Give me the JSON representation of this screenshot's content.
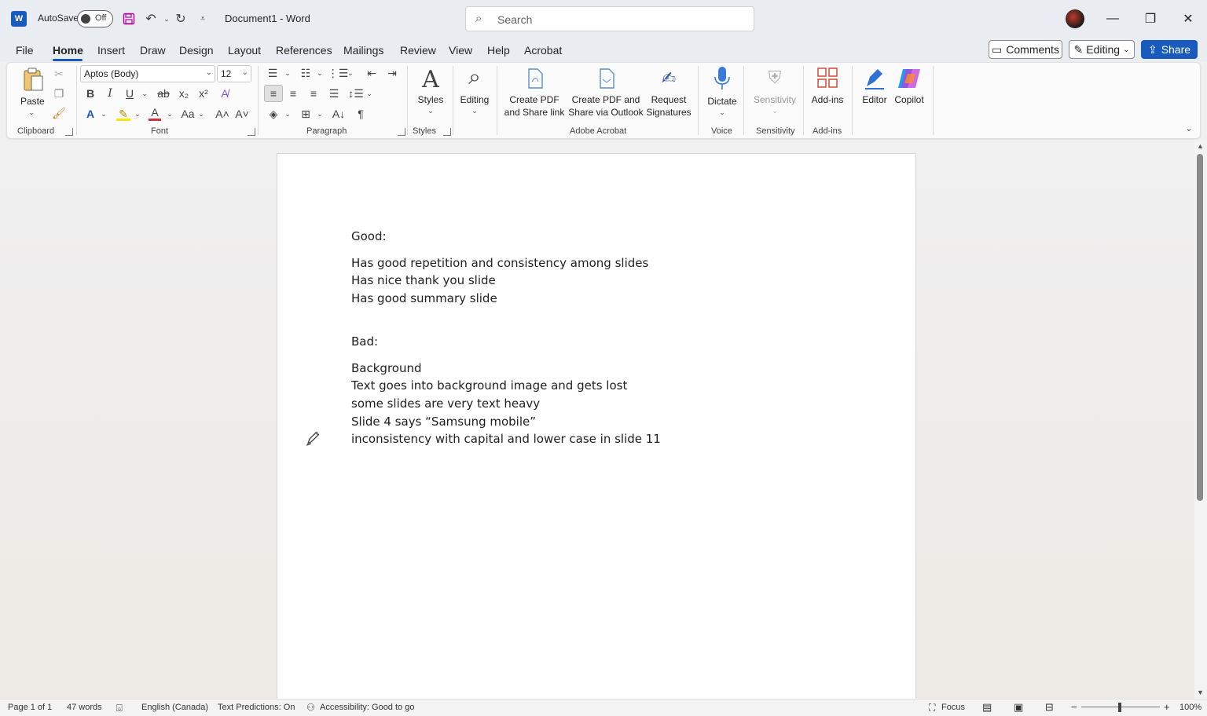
{
  "titlebar": {
    "app_logo": "W",
    "autosave_label": "AutoSave",
    "autosave_state": "Off",
    "document_title": "Document1 - Word",
    "search_placeholder": "Search"
  },
  "tabs": [
    "File",
    "Home",
    "Insert",
    "Draw",
    "Design",
    "Layout",
    "References",
    "Mailings",
    "Review",
    "View",
    "Help",
    "Acrobat"
  ],
  "active_tab": "Home",
  "actions": {
    "comments": "Comments",
    "editing": "Editing",
    "share": "Share"
  },
  "ribbon": {
    "clipboard": {
      "label": "Clipboard",
      "paste": "Paste"
    },
    "font": {
      "label": "Font",
      "font_name": "Aptos (Body)",
      "font_size": "12"
    },
    "paragraph": {
      "label": "Paragraph"
    },
    "styles": {
      "label": "Styles",
      "styles_btn": "Styles"
    },
    "editing": {
      "editing_btn": "Editing"
    },
    "adobe": {
      "label": "Adobe Acrobat",
      "create_pdf_link_1": "Create PDF",
      "create_pdf_link_2": "and Share link",
      "create_pdf_outlook_1": "Create PDF and",
      "create_pdf_outlook_2": "Share via Outlook",
      "request_sig_1": "Request",
      "request_sig_2": "Signatures"
    },
    "voice": {
      "label": "Voice",
      "dictate": "Dictate"
    },
    "sensitivity": {
      "label": "Sensitivity",
      "btn": "Sensitivity"
    },
    "addins": {
      "label": "Add-ins",
      "btn": "Add-ins"
    },
    "editor": "Editor",
    "copilot": "Copilot"
  },
  "document": {
    "lines": [
      "Good:",
      "Has good repetition and consistency among slides",
      "Has nice thank you slide",
      "Has good summary slide",
      "Bad:",
      "Background",
      "Text goes into background image and gets lost",
      "some slides are very text heavy",
      "Slide 4 says “Samsung mobile”",
      "inconsistency with capital and lower case in slide 11"
    ]
  },
  "statusbar": {
    "page": "Page 1 of 1",
    "words": "47 words",
    "language": "English (Canada)",
    "text_predictions": "Text Predictions: On",
    "accessibility": "Accessibility: Good to go",
    "focus": "Focus",
    "zoom": "100%"
  },
  "colors": {
    "accent": "#185abd",
    "titlebar_bg": "#e9edf2"
  }
}
